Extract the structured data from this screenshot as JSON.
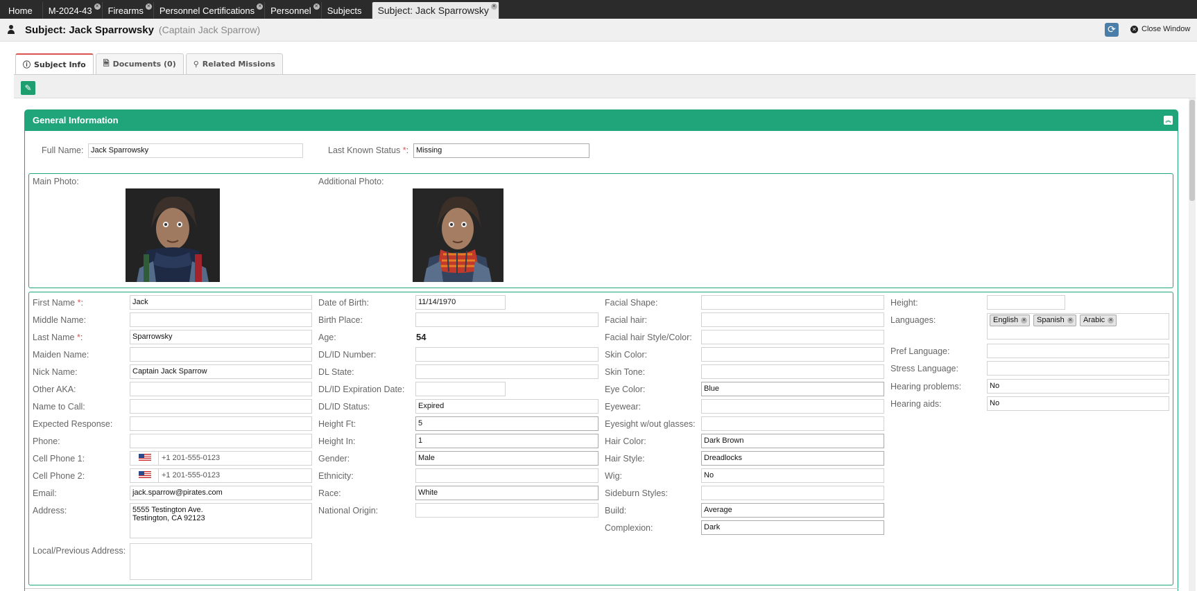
{
  "tabs": [
    {
      "label": "Home",
      "closable": false
    },
    {
      "label": "M-2024-43",
      "closable": true
    },
    {
      "label": "Firearms",
      "closable": true
    },
    {
      "label": "Personnel Certifications",
      "closable": true
    },
    {
      "label": "Personnel",
      "closable": true
    },
    {
      "label": "Subjects",
      "closable": false
    },
    {
      "label": "Subject: Jack Sparrowsky",
      "closable": true,
      "active": true
    }
  ],
  "header": {
    "title": "Subject: Jack Sparrowsky",
    "alias": "(Captain Jack Sparrow)",
    "close_label": "Close Window"
  },
  "subtabs": [
    {
      "label": "Subject Info",
      "icon": "info-icon",
      "active": true
    },
    {
      "label": "Documents (0)",
      "icon": "document-icon"
    },
    {
      "label": "Related Missions",
      "icon": "search-icon"
    }
  ],
  "section": {
    "title": "General Information"
  },
  "top_fields": {
    "full_name_label": "Full Name:",
    "full_name": "Jack Sparrowsky",
    "status_label": "Last Known Status",
    "status": "Missing"
  },
  "photos": {
    "main_label": "Main Photo:",
    "additional_label": "Additional Photo:"
  },
  "col1": [
    {
      "label": "First Name",
      "req": true,
      "value": "Jack"
    },
    {
      "label": "Middle Name:",
      "value": ""
    },
    {
      "label": "Last Name",
      "req": true,
      "value": "Sparrowsky"
    },
    {
      "label": "Maiden Name:",
      "value": ""
    },
    {
      "label": "Nick Name:",
      "value": "Captain Jack Sparrow"
    },
    {
      "label": "Other AKA:",
      "value": ""
    },
    {
      "label": "Name to Call:",
      "value": ""
    },
    {
      "label": "Expected Response:",
      "value": ""
    },
    {
      "label": "Phone:",
      "value": ""
    },
    {
      "label": "Cell Phone 1:",
      "placeholder": "+1 201-555-0123"
    },
    {
      "label": "Cell Phone 2:",
      "placeholder": "+1 201-555-0123"
    },
    {
      "label": "Email:",
      "value": "jack.sparrow@pirates.com"
    },
    {
      "label": "Address:",
      "value": "5555 Testington Ave.\nTestington, CA 92123"
    },
    {
      "label": "Local/Previous Address:",
      "value": ""
    }
  ],
  "col2": [
    {
      "label": "Date of Birth:",
      "value": "11/14/1970"
    },
    {
      "label": "Birth Place:",
      "value": ""
    },
    {
      "label": "Age:",
      "value": "54"
    },
    {
      "label": "DL/ID Number:",
      "value": ""
    },
    {
      "label": "DL State:",
      "value": ""
    },
    {
      "label": "DL/ID Expiration Date:",
      "value": ""
    },
    {
      "label": "DL/ID Status:",
      "value": "Expired"
    },
    {
      "label": "Height Ft:",
      "value": "5"
    },
    {
      "label": "Height In:",
      "value": "1"
    },
    {
      "label": "Gender:",
      "value": "Male"
    },
    {
      "label": "Ethnicity:",
      "value": ""
    },
    {
      "label": "Race:",
      "value": "White"
    },
    {
      "label": "National Origin:",
      "value": ""
    }
  ],
  "col3": [
    {
      "label": "Facial Shape:",
      "value": ""
    },
    {
      "label": "Facial hair:",
      "value": ""
    },
    {
      "label": "Facial hair Style/Color:",
      "value": ""
    },
    {
      "label": "Skin Color:",
      "value": ""
    },
    {
      "label": "Skin Tone:",
      "value": ""
    },
    {
      "label": "Eye Color:",
      "value": "Blue"
    },
    {
      "label": "Eyewear:",
      "value": ""
    },
    {
      "label": "Eyesight w/out glasses:",
      "value": ""
    },
    {
      "label": "Hair Color:",
      "value": "Dark Brown"
    },
    {
      "label": "Hair Style:",
      "value": "Dreadlocks"
    },
    {
      "label": "Wig:",
      "value": "No"
    },
    {
      "label": "Sideburn Styles:",
      "value": ""
    },
    {
      "label": "Build:",
      "value": "Average"
    },
    {
      "label": "Complexion:",
      "value": "Dark"
    }
  ],
  "col4": [
    {
      "label": "Height:",
      "value": ""
    },
    {
      "label": "Languages:",
      "chips": [
        "English",
        "Spanish",
        "Arabic"
      ]
    },
    {
      "label": "Pref Language:",
      "value": ""
    },
    {
      "label": "Stress Language:",
      "value": ""
    },
    {
      "label": "Hearing problems:",
      "value": "No"
    },
    {
      "label": "Hearing aids:",
      "value": "No"
    }
  ],
  "colors": {
    "accent": "#1fa579",
    "required": "#d9534f",
    "tabbar": "#2b2b2b"
  }
}
